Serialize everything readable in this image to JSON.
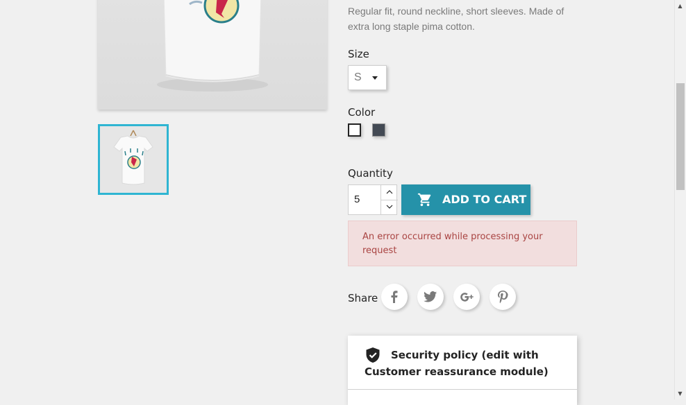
{
  "product": {
    "description": "Regular fit, round neckline, short sleeves. Made of extra long staple pima cotton."
  },
  "size": {
    "label": "Size",
    "selected": "S"
  },
  "color": {
    "label": "Color",
    "swatches": [
      {
        "name": "White",
        "hex": "#ffffff",
        "selected": true
      },
      {
        "name": "Grey",
        "hex": "#434a54",
        "selected": false
      }
    ]
  },
  "quantity": {
    "label": "Quantity",
    "value": "5"
  },
  "cart": {
    "button_label": "ADD TO CART",
    "icon": "shopping-cart-icon",
    "color": "#2592a9"
  },
  "alert": {
    "message": "An error occurred while processing your request",
    "bg": "#f2dede",
    "text_color": "#a94442"
  },
  "share": {
    "label": "Share",
    "networks": [
      "facebook-icon",
      "twitter-icon",
      "google-plus-icon",
      "pinterest-icon"
    ]
  },
  "reassurance": {
    "title": "Security policy (edit with Customer reassurance module)",
    "icon": "shield-check-icon"
  },
  "theme": {
    "accent": "#2fb5d2",
    "background": "#f0f0f0"
  }
}
